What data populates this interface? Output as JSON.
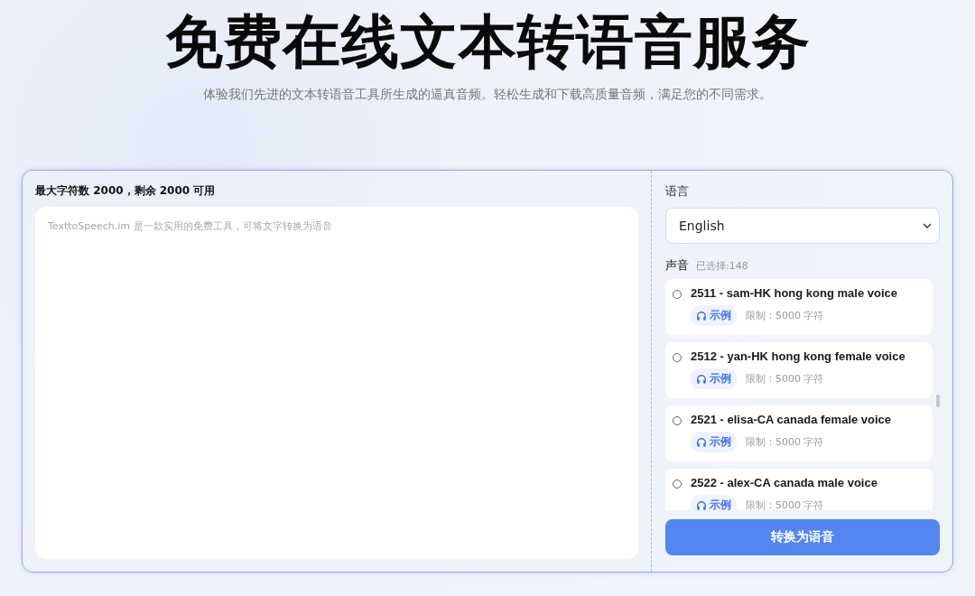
{
  "header": {
    "title": "免费在线文本转语音服务",
    "subtitle": "体验我们先进的文本转语音工具所生成的逼真音频。轻松生成和下载高质量音频，满足您的不同需求。"
  },
  "editor": {
    "counter": "最大字符数 2000，剩余 2000 可用",
    "placeholder": "TexttoSpeech.im 是一款实用的免费工具，可将文字转换为语音"
  },
  "language": {
    "label": "语言",
    "value": "English"
  },
  "voices": {
    "label": "声音",
    "count": "已选择:148",
    "items": [
      {
        "name": "2511 - sam-HK hong kong male voice",
        "sample": "示例",
        "limit": "限制：5000 字符",
        "selected": false
      },
      {
        "name": "2512 - yan-HK hong kong female voice",
        "sample": "示例",
        "limit": "限制：5000 字符",
        "selected": false
      },
      {
        "name": "2521 - elisa-CA canada female voice",
        "sample": "示例",
        "limit": "限制：5000 字符",
        "selected": false
      },
      {
        "name": "2522 - alex-CA canada male voice",
        "sample": "示例",
        "limit": "限制：5000 字符",
        "selected": false
      }
    ]
  },
  "convert_button": "转换为语音"
}
